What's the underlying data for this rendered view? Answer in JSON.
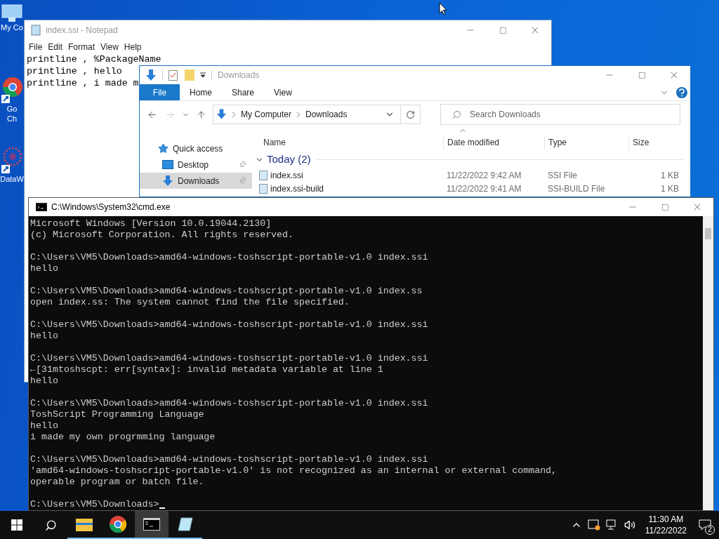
{
  "desktop_icons": [
    {
      "kind": "computer",
      "label_lines": [
        "My Co"
      ]
    },
    {
      "kind": "chrome",
      "label_lines": [
        "Go",
        "Ch"
      ]
    },
    {
      "kind": "dataw",
      "label_lines": [
        "DataW"
      ]
    }
  ],
  "notepad": {
    "title": "index.ssi - Notepad",
    "menu": [
      "File",
      "Edit",
      "Format",
      "View",
      "Help"
    ],
    "lines": [
      "printline , %PackageName",
      "printline , hello",
      "printline , i made m"
    ]
  },
  "explorer": {
    "title": "Downloads",
    "tabs": [
      {
        "label": "File",
        "selected": true
      },
      {
        "label": "Home",
        "selected": false
      },
      {
        "label": "Share",
        "selected": false
      },
      {
        "label": "View",
        "selected": false
      }
    ],
    "nav_buttons": [
      {
        "kind": "back",
        "disabled": false
      },
      {
        "kind": "forward",
        "disabled": true
      },
      {
        "kind": "recent",
        "disabled": false
      },
      {
        "kind": "up",
        "disabled": false
      }
    ],
    "breadcrumb": [
      "My Computer",
      "Downloads"
    ],
    "search": {
      "placeholder": "Search Downloads"
    },
    "nav_pane": [
      {
        "kind": "star",
        "label": "Quick access",
        "selected": false,
        "pinned": false
      },
      {
        "kind": "desktop",
        "label": "Desktop",
        "selected": false,
        "pinned": true
      },
      {
        "kind": "download",
        "label": "Downloads",
        "selected": true,
        "pinned": true
      }
    ],
    "columns": [
      "Name",
      "Date modified",
      "Type",
      "Size"
    ],
    "group": "Today (2)",
    "rows": [
      {
        "name": "index.ssi",
        "date": "11/22/2022 9:42 AM",
        "type": "SSI File",
        "size": "1 KB"
      },
      {
        "name": "index.ssi-build",
        "date": "11/22/2022 9:41 AM",
        "type": "SSI-BUILD File",
        "size": "1 KB"
      }
    ]
  },
  "cmd": {
    "title": "C:\\Windows\\System32\\cmd.exe",
    "blocks": [
      [
        "Microsoft Windows [Version 10.0.19044.2130]",
        "(c) Microsoft Corporation. All rights reserved."
      ],
      [
        "C:\\Users\\VM5\\Downloads>amd64-windows-toshscript-portable-v1.0 index.ssi",
        "hello"
      ],
      [
        "C:\\Users\\VM5\\Downloads>amd64-windows-toshscript-portable-v1.0 index.ss",
        "open index.ss: The system cannot find the file specified."
      ],
      [
        "C:\\Users\\VM5\\Downloads>amd64-windows-toshscript-portable-v1.0 index.ssi",
        "hello"
      ],
      [
        "C:\\Users\\VM5\\Downloads>amd64-windows-toshscript-portable-v1.0 index.ssi",
        "←[31mtoshscpt: err[syntax]: invalid metadata variable at line 1",
        "hello"
      ],
      [
        "C:\\Users\\VM5\\Downloads>amd64-windows-toshscript-portable-v1.0 index.ssi",
        "ToshScript Programming Language",
        "hello",
        "i made my own progrmming language"
      ],
      [
        "C:\\Users\\VM5\\Downloads>amd64-windows-toshscript-portable-v1.0 index.ssi",
        "'amd64-windows-toshscript-portable-v1.0' is not recognized as an internal or external command,",
        "operable program or batch file."
      ],
      [
        "C:\\Users\\VM5\\Downloads>"
      ]
    ]
  },
  "taskbar": {
    "apps": [
      {
        "kind": "explorer",
        "selected": false
      },
      {
        "kind": "chrome",
        "selected": false
      },
      {
        "kind": "cmd",
        "selected": true
      },
      {
        "kind": "notepad",
        "selected": false
      }
    ],
    "time": "11:30 AM",
    "date": "11/22/2022",
    "notifications": "2"
  }
}
